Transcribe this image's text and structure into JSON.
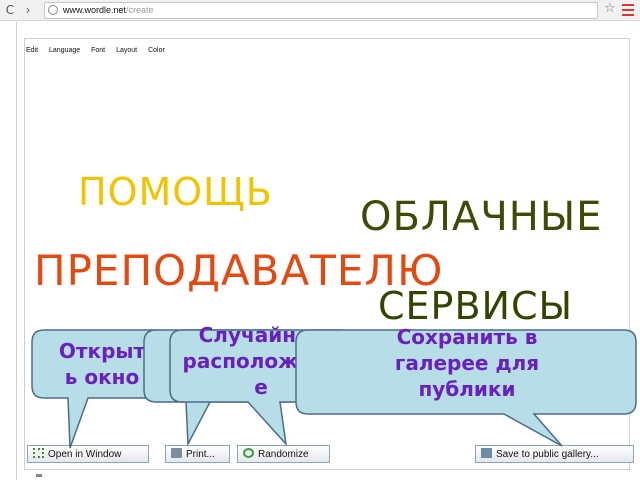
{
  "browser": {
    "back_glyph": "C",
    "forward_glyph": "›",
    "url_host": "www.wordle.net",
    "url_path": "/create",
    "star_glyph": "☆"
  },
  "menubar": {
    "items": [
      "Edit",
      "Language",
      "Font",
      "Layout",
      "Color"
    ]
  },
  "cloud": {
    "words": [
      {
        "text": "ПОМОЩЬ",
        "color": "#f2c300"
      },
      {
        "text": "ОБЛАЧНЫЕ",
        "color": "#3f4a05"
      },
      {
        "text": "ПРЕПОДАВАТЕЛЮ",
        "color": "#e24a12"
      },
      {
        "text": "СЕРВИСЫ",
        "color": "#334400"
      }
    ]
  },
  "buttons": {
    "open": "Open in Window",
    "print": "Print...",
    "randomize": "Randomize",
    "save": "Save to public gallery..."
  },
  "callouts": {
    "open_line1": "Открыт",
    "open_line2": "ь окно",
    "random_line1": "Случайное",
    "random_line2": "расположени",
    "random_line3": "е",
    "save_line1": "Сохранить в",
    "save_line2": "галерее для",
    "save_line3": "публики"
  },
  "colors": {
    "callout_fill": "#b7dde7",
    "callout_stroke": "#4b6c88",
    "callout_text": "#6a1fbf"
  }
}
